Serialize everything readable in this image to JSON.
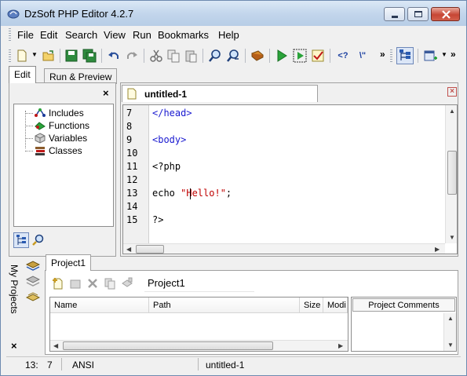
{
  "window": {
    "title": "DzSoft PHP Editor 4.2.7"
  },
  "menu": [
    "File",
    "Edit",
    "Search",
    "View",
    "Run",
    "Bookmarks",
    "Help"
  ],
  "toolbar": {
    "php_tag_label": "<?",
    "escape_label": "\\\"",
    "overflow_label": "»"
  },
  "main_tabs": {
    "edit": "Edit",
    "run_preview": "Run & Preview"
  },
  "left_panel": {
    "close_label": "×",
    "tree": [
      {
        "label": "Includes",
        "icon": "includes-icon"
      },
      {
        "label": "Functions",
        "icon": "functions-icon"
      },
      {
        "label": "Variables",
        "icon": "variables-icon"
      },
      {
        "label": "Classes",
        "icon": "classes-icon"
      }
    ]
  },
  "editor": {
    "tab_title": "untitled-1",
    "close_label": "×",
    "lines": [
      {
        "num": "7",
        "text": "</head>",
        "color": "#1a1ad0"
      },
      {
        "num": "8",
        "text": "",
        "color": "#000000"
      },
      {
        "num": "9",
        "text": "<body>",
        "color": "#1a1ad0"
      },
      {
        "num": "10",
        "text": "",
        "color": "#000000"
      },
      {
        "num": "11",
        "text": "<?php",
        "color": "#000000"
      },
      {
        "num": "12",
        "text": "",
        "color": "#000000"
      },
      {
        "num": "13",
        "text": "echo ",
        "string": "\"Hello!\"",
        "after": ";",
        "color": "#000000",
        "string_color": "#c00000"
      },
      {
        "num": "14",
        "text": "",
        "color": "#000000"
      },
      {
        "num": "15",
        "text": "?>",
        "color": "#000000"
      }
    ]
  },
  "projects": {
    "side_label": "My Projects",
    "close_label": "×",
    "tab": "Project1",
    "name_value": "Project1",
    "columns": [
      "Name",
      "Path",
      "Size",
      "Modi"
    ],
    "comments_header": "Project Comments"
  },
  "status": {
    "line": "13:",
    "col": "7",
    "encoding": "ANSI",
    "file": "untitled-1"
  }
}
